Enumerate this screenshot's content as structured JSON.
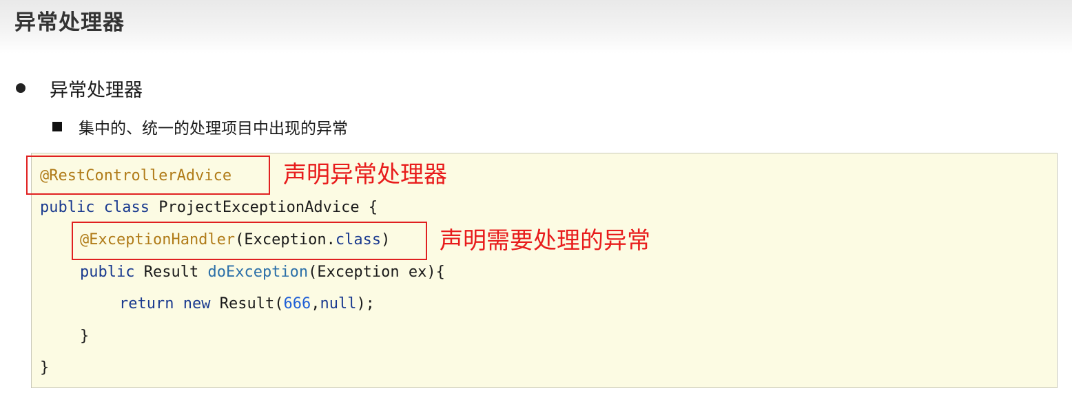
{
  "header": {
    "title": "异常处理器"
  },
  "bullet": {
    "text": "异常处理器"
  },
  "sub_bullet": {
    "text": "集中的、统一的处理项目中出现的异常"
  },
  "code": {
    "line1_annotation": "@RestControllerAdvice",
    "line2_kw": "public",
    "line2_kw2": "class",
    "line2_rest": "ProjectExceptionAdvice {",
    "line3_annotation": "@ExceptionHandler",
    "line3_paren_open": "(Exception.",
    "line3_kw": "class",
    "line3_paren_close": ")",
    "line4_kw": "public",
    "line4_type": "Result",
    "line4_method": "doException",
    "line4_rest": "(Exception ex){",
    "line5_kw": "return",
    "line5_kw2": "new",
    "line5_call": "Result(",
    "line5_num": "666",
    "line5_comma": ",",
    "line5_null": "null",
    "line5_end": ");",
    "line6": "}",
    "line7": "}"
  },
  "callouts": {
    "advice": "声明异常处理器",
    "handler": "声明需要处理的异常"
  },
  "colors": {
    "annotation": "#b07b18",
    "keyword": "#1a3a8f",
    "number": "#1f5fd6",
    "callout": "#e81c1c",
    "code_background": "#fcfbe3"
  }
}
